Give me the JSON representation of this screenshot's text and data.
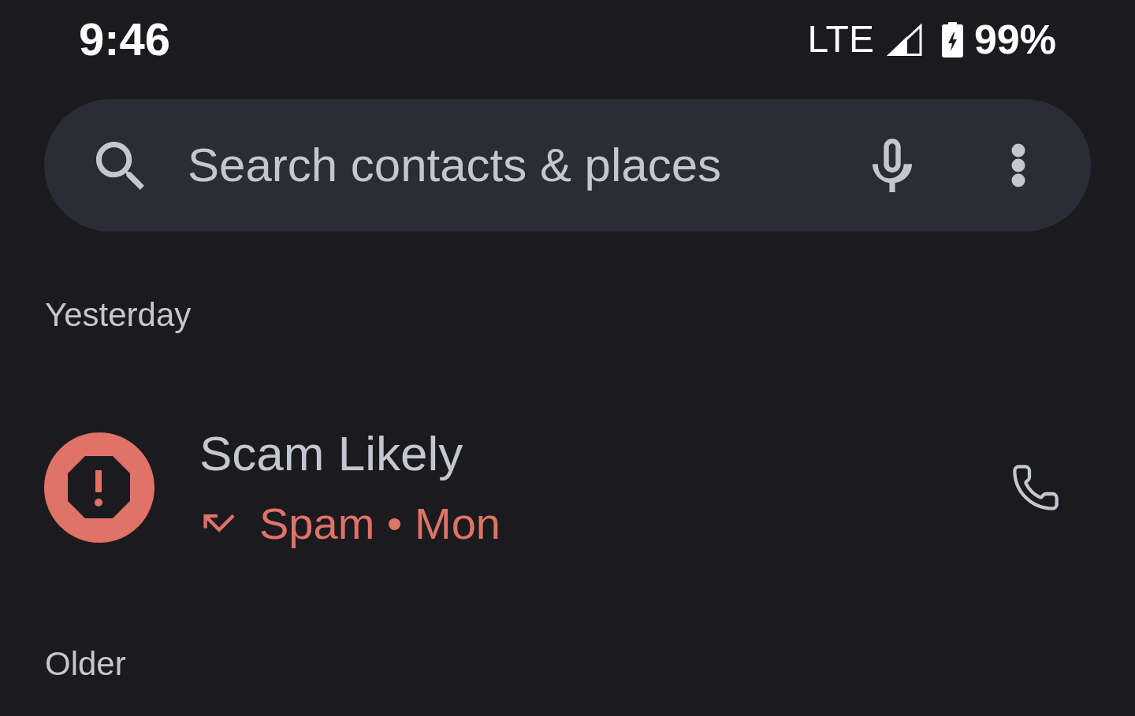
{
  "status_bar": {
    "time": "9:46",
    "network": "LTE",
    "battery": "99%"
  },
  "search": {
    "placeholder": "Search contacts & places"
  },
  "sections": [
    {
      "heading": "Yesterday",
      "calls": [
        {
          "name": "Scam Likely",
          "spam": true,
          "kind": "missed",
          "detail": "Spam • Mon"
        }
      ]
    },
    {
      "heading": "Older"
    }
  ]
}
